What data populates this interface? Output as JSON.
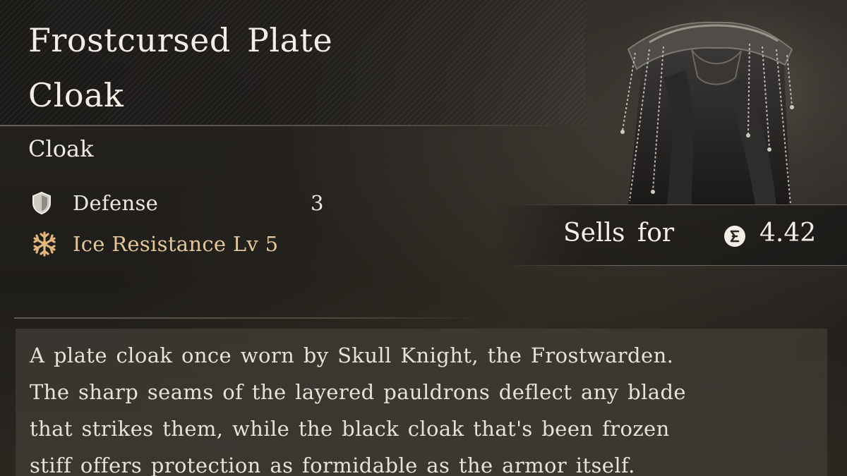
{
  "item": {
    "title_line1": "Frostcursed Plate",
    "title_line2": "Cloak",
    "type": "Cloak",
    "art_icon": "cloak-icon"
  },
  "stats": [
    {
      "icon": "shield-icon",
      "label": "Defense",
      "value": "3",
      "color": "#ece8df"
    },
    {
      "icon": "snowflake-icon",
      "label": "Ice Resistance Lv 5",
      "color": "#e3c699"
    }
  ],
  "sell": {
    "label": "Sells for",
    "currency_icon": "coin-icon",
    "value": "4.42"
  },
  "description": {
    "lines": [
      "A plate cloak once worn by Skull Knight, the Frostwarden.",
      "The sharp seams of the layered pauldrons deflect any blade",
      "that strikes them, while the black cloak that's been frozen",
      "stiff offers protection as formidable as the armor itself."
    ]
  }
}
